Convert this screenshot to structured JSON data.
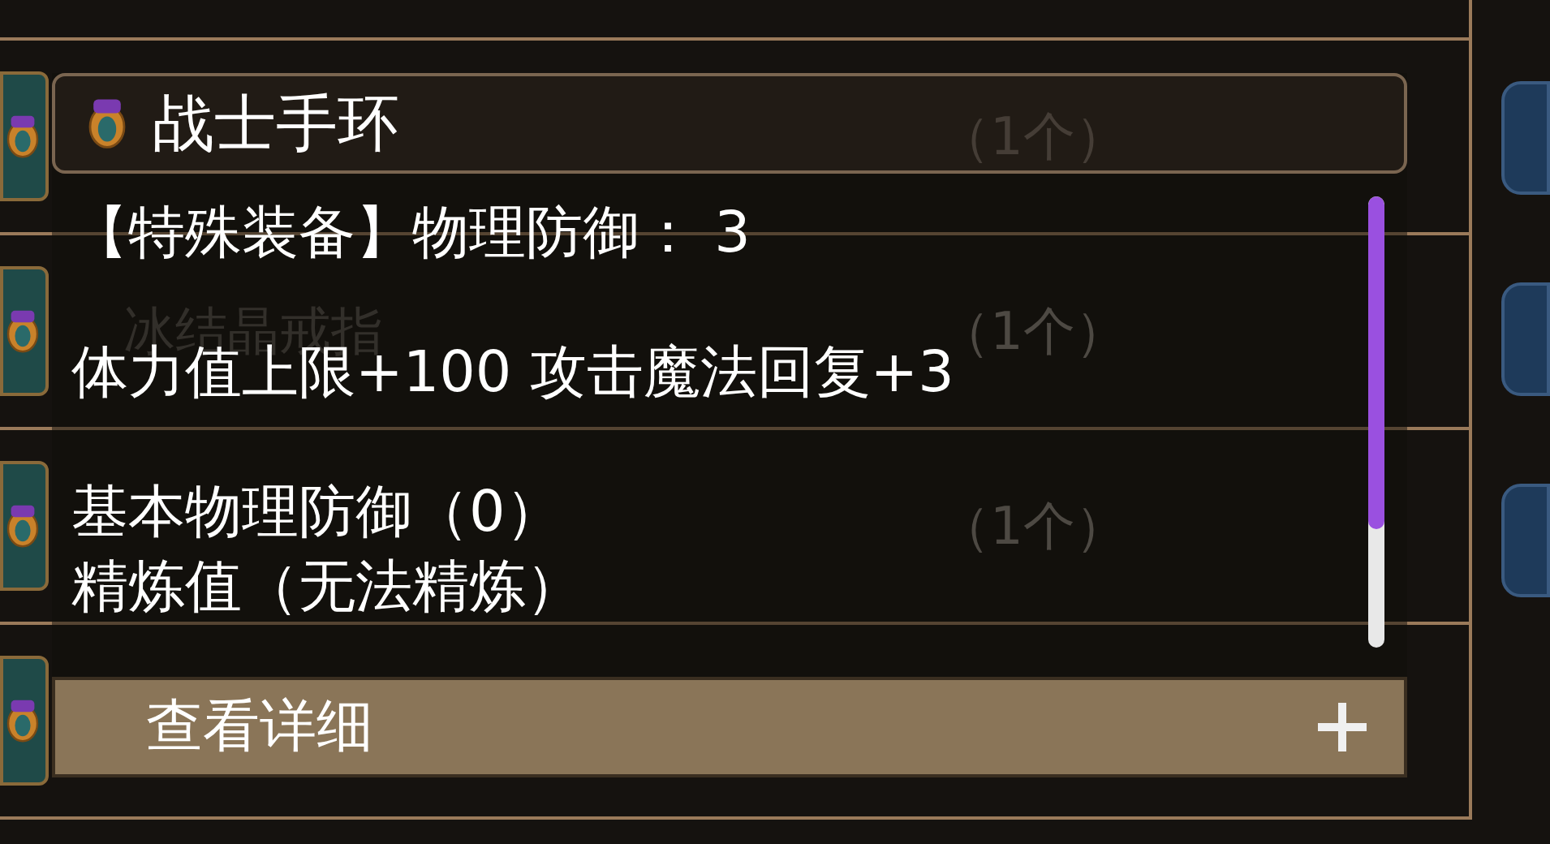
{
  "background_list": {
    "rows": [
      {
        "count": "（1个）"
      },
      {
        "name": "冰结晶戒指",
        "count": "（1个）"
      },
      {
        "count": "（1个）"
      },
      {}
    ]
  },
  "tooltip": {
    "title": "战士手环",
    "stats": [
      "【特殊装备】物理防御： 3",
      "体力值上限+100 攻击魔法回复+3"
    ],
    "base": [
      "基本物理防御（0）",
      "精炼值（无法精炼）"
    ],
    "detail_button": {
      "label": "查看详细"
    }
  }
}
